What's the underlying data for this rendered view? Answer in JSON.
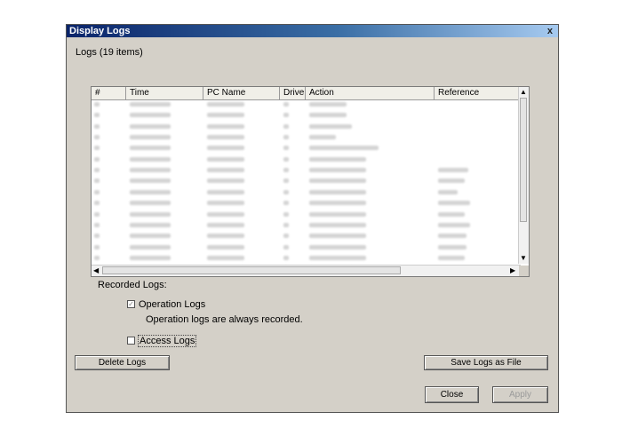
{
  "window": {
    "title": "Display Logs",
    "close_glyph": "x"
  },
  "logs_count_label": "Logs (19 items)",
  "table": {
    "columns": [
      "#",
      "Time",
      "PC Name",
      "Drive",
      "Action",
      "Reference"
    ],
    "rows_note_redacted": true
  },
  "recorded_logs": {
    "heading": "Recorded Logs:",
    "operation_logs": {
      "label": "Operation Logs",
      "checked": true,
      "disabled": true,
      "note": "Operation logs are always recorded."
    },
    "access_logs": {
      "label": "Access Logs",
      "checked": false
    }
  },
  "buttons": {
    "delete": "Delete Logs",
    "save": "Save Logs as File",
    "close": "Close",
    "apply": "Apply"
  },
  "scroll_glyphs": {
    "up": "▲",
    "down": "▼",
    "left": "◀",
    "right": "▶"
  }
}
